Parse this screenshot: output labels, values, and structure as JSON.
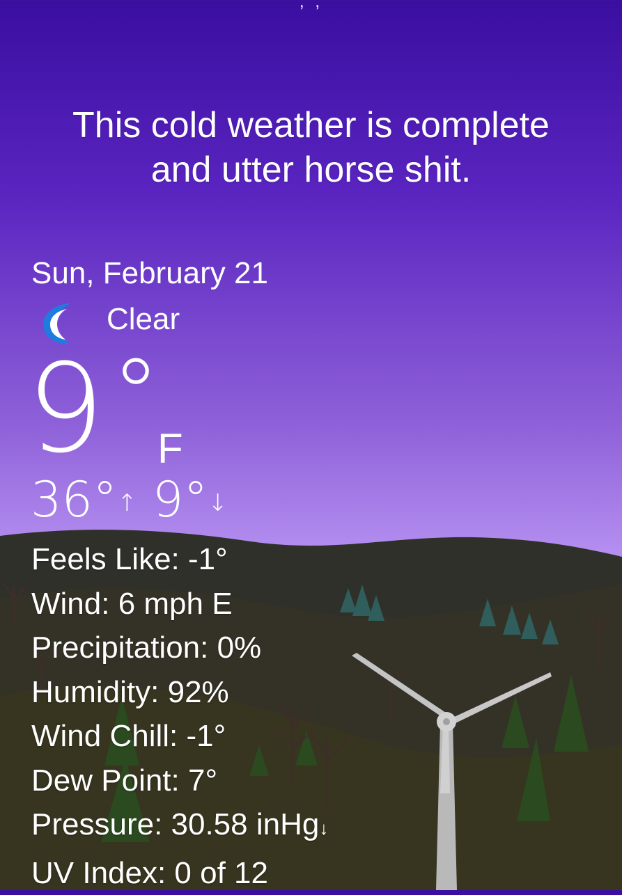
{
  "top_partial_text": ", ,",
  "headline": {
    "line1": "This cold weather is complete",
    "line2": "and utter horse shit."
  },
  "current": {
    "date": "Sun, February 21",
    "condition": "Clear",
    "condition_icon": "moon-icon",
    "temperature": "9",
    "degree": "°",
    "unit": "F",
    "high": "36°",
    "low": "9°",
    "high_arrow": "↑",
    "low_arrow": "↓"
  },
  "details": {
    "feels_like": "Feels Like: -1°",
    "wind": "Wind: 6 mph E",
    "precipitation": "Precipitation: 0%",
    "humidity": "Humidity: 92%",
    "wind_chill": "Wind Chill: -1°",
    "dew_point": "Dew Point: 7°",
    "pressure": "Pressure: 30.58 inHg",
    "pressure_arrow": "↓",
    "uv_index": "UV Index: 0 of 12"
  },
  "colors": {
    "sky_top": "#3a0fa0",
    "sky_bottom": "#c8a6f4",
    "hill_dark": "#2e2e24",
    "moon_blue": "#1e7be0"
  }
}
